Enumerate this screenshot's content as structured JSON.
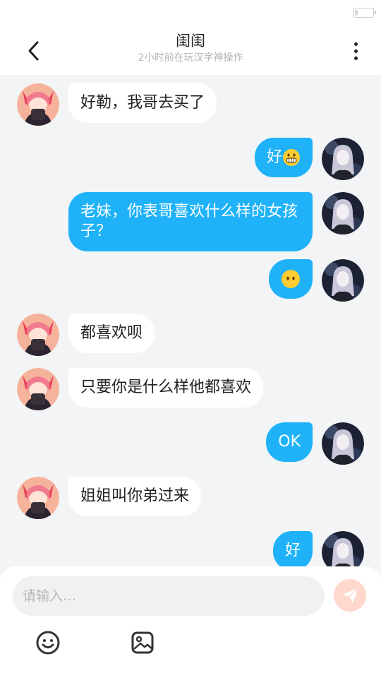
{
  "status_bar": {
    "battery_icon": "battery-icon",
    "battery_level": 0.15
  },
  "header": {
    "title": "闺闺",
    "subtitle": "2小时前在玩汉字神操作",
    "back_icon": "chevron-left-icon",
    "more_icon": "more-vertical-icon"
  },
  "messages": [
    {
      "side": "left",
      "text": "好勒，我哥去买了"
    },
    {
      "side": "right",
      "text": "好",
      "emoji": "grinning-face-emoji"
    },
    {
      "side": "right",
      "text": "老妹，你表哥喜欢什么样的女孩子？"
    },
    {
      "side": "right",
      "text": "",
      "emoji": "neutral-face-emoji"
    },
    {
      "side": "left",
      "text": "都喜欢呗"
    },
    {
      "side": "left",
      "text": "只要你是什么样他都喜欢"
    },
    {
      "side": "right",
      "text": "OK"
    },
    {
      "side": "left",
      "text": "姐姐叫你弟过来"
    },
    {
      "side": "right",
      "text": "好"
    }
  ],
  "composer": {
    "placeholder": "请输入…",
    "value": "",
    "send_icon": "send-icon",
    "emoji_icon": "smiley-icon",
    "image_icon": "image-icon"
  },
  "colors": {
    "my_bubble": "#1fb2f8",
    "their_bubble": "#ffffff",
    "background": "#f3f4f6",
    "send_button": "#ffd7cc"
  }
}
